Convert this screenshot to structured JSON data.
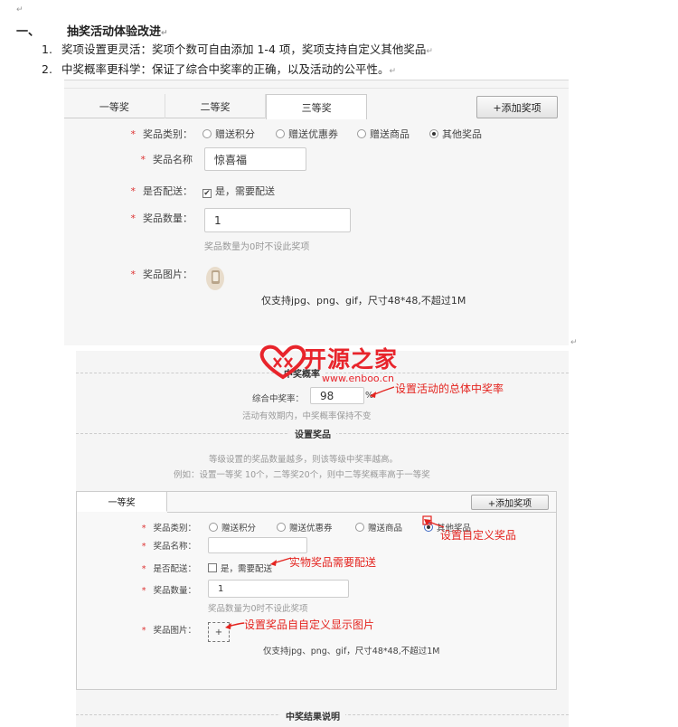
{
  "doc": {
    "return_mark": "↵",
    "section_num": "一、",
    "section_title": "抽奖活动体验改进",
    "items": [
      {
        "num": "1.",
        "text": "奖项设置更灵活：奖项个数可自由添加 1-4 项，奖项支持自定义其他奖品"
      },
      {
        "num": "2.",
        "text": "中奖概率更科学：保证了综合中奖率的正确，以及活动的公平性。"
      }
    ]
  },
  "shot1": {
    "tabs": [
      "一等奖",
      "二等奖",
      "三等奖"
    ],
    "add_button": "+添加奖项",
    "star": "*",
    "labels": {
      "category": "奖品类别：",
      "name": "奖品名称",
      "delivery": "是否配送：",
      "quantity": "奖品数量：",
      "image": "奖品图片："
    },
    "category_options": [
      "赠送积分",
      "赠送优惠券",
      "赠送商品",
      "其他奖品"
    ],
    "selected_option": "其他奖品",
    "name_value": "惊喜福",
    "delivery_text": "是，需要配送",
    "delivery_checked": true,
    "quantity_value": "1",
    "quantity_hint": "奖品数量为0时不设此奖项",
    "image_note": "仅支持jpg、png、gif，尺寸48*48,不超过1M"
  },
  "shot2": {
    "prob_heading": "中奖概率",
    "rate_label": "综合中奖率：",
    "rate_value": "98",
    "rate_unit": "%",
    "rate_hint": "活动有效期内，中奖概率保持不变",
    "prize_heading": "设置奖品",
    "prize_hint1": "等级设置的奖品数量越多，则该等级中奖率越高。",
    "prize_hint2": "例如：设置一等奖 10个，二等奖20个，则中二等奖概率高于一等奖",
    "tab": "一等奖",
    "add_button": "+添加奖项",
    "star": "*",
    "labels": {
      "category": "奖品类别：",
      "name": "奖品名称：",
      "delivery": "是否配送：",
      "quantity": "奖品数量：",
      "image": "奖品图片："
    },
    "category_options": [
      "赠送积分",
      "赠送优惠券",
      "赠送商品",
      "其他奖品"
    ],
    "selected_option": "其他奖品",
    "delivery_text": "是，需要配送",
    "delivery_checked": false,
    "quantity_value": "1",
    "quantity_hint": "奖品数量为0时不设此奖项",
    "upload_plus": "+",
    "image_note": "仅支持jpg、png、gif，尺寸48*48,不超过1M",
    "result_heading": "中奖结果说明"
  },
  "annotations": {
    "rate": "设置活动的总体中奖率",
    "custom_prize": "设置自定义奖品",
    "delivery": "实物奖品需要配送",
    "image": "设置奖品自自定义显示图片"
  },
  "watermark": {
    "brand": "开源之家",
    "url": "www.enboo.cn"
  },
  "colors": {
    "annotation": "#e4241f",
    "watermark": "#e8242b"
  }
}
